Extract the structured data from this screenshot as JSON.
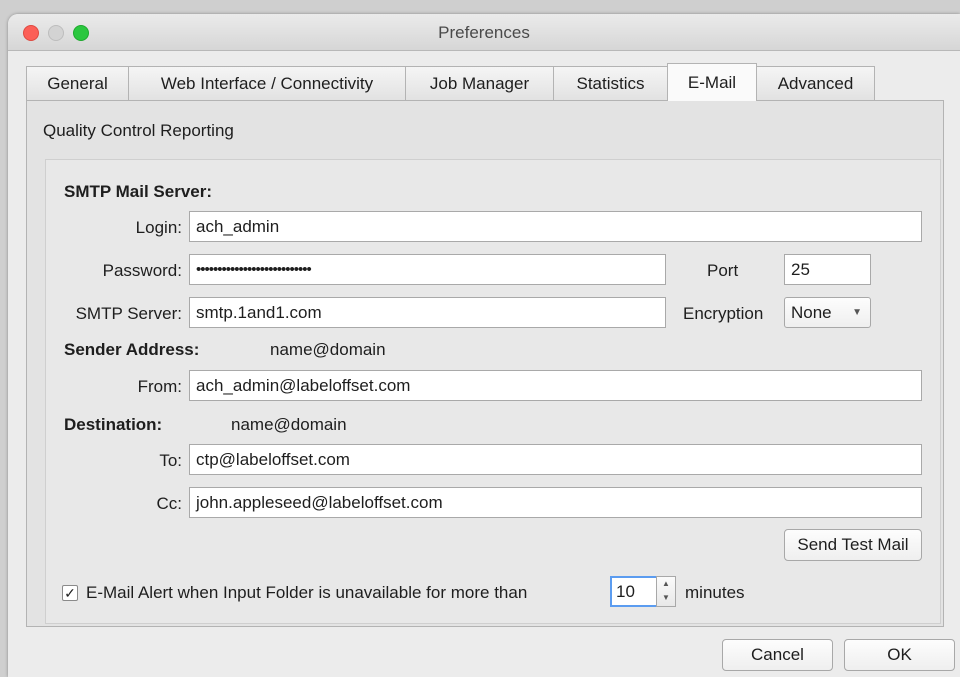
{
  "window": {
    "title": "Preferences"
  },
  "tabs": [
    {
      "label": "General"
    },
    {
      "label": "Web Interface / Connectivity"
    },
    {
      "label": "Job Manager"
    },
    {
      "label": "Statistics"
    },
    {
      "label": "E-Mail"
    },
    {
      "label": "Advanced"
    }
  ],
  "active_tab": "E-Mail",
  "section": {
    "title": "Quality Control Reporting"
  },
  "smtp": {
    "heading": "SMTP Mail Server:",
    "login_label": "Login:",
    "login_value": "ach_admin",
    "password_label": "Password:",
    "password_value": "•••••••••••••••••••••••••••",
    "port_label": "Port",
    "port_value": "25",
    "server_label": "SMTP Server:",
    "server_value": "smtp.1and1.com",
    "encryption_label": "Encryption",
    "encryption_value": "None"
  },
  "sender": {
    "heading": "Sender Address:",
    "hint": "name@domain",
    "from_label": "From:",
    "from_value": "ach_admin@labeloffset.com"
  },
  "destination": {
    "heading": "Destination:",
    "hint": "name@domain",
    "to_label": "To:",
    "to_value": "ctp@labeloffset.com",
    "cc_label": "Cc:",
    "cc_value": "john.appleseed@labeloffset.com"
  },
  "buttons": {
    "send_test": "Send Test Mail",
    "cancel": "Cancel",
    "ok": "OK"
  },
  "alert": {
    "checked": true,
    "check_glyph": "✓",
    "label": "E-Mail Alert when Input Folder is unavailable for more than",
    "minutes_value": "10",
    "unit": "minutes"
  },
  "colors": {
    "focus": "#5b9cf0",
    "close": "#fc5f57",
    "zoom": "#2bc73f"
  },
  "icons": {
    "spin_up": "▲",
    "spin_down": "▼",
    "select_caret": "▼"
  }
}
